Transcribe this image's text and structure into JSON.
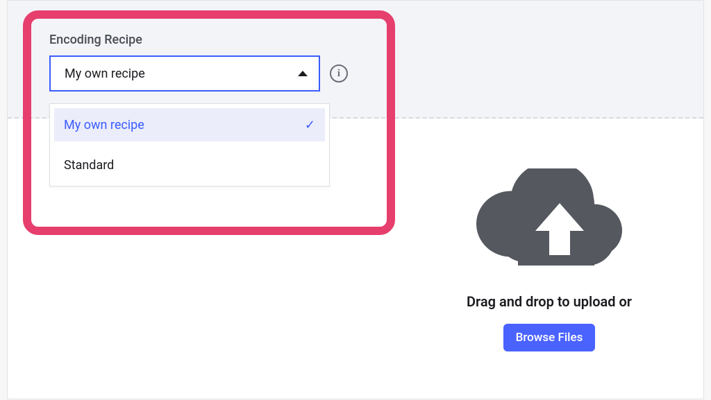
{
  "encoding_recipe": {
    "label": "Encoding Recipe",
    "selected_value": "My own recipe",
    "info_icon": "info-icon",
    "options": [
      {
        "label": "My own recipe",
        "selected": true
      },
      {
        "label": "Standard",
        "selected": false
      }
    ]
  },
  "upload": {
    "instruction": "Drag and drop to upload or",
    "button_label": "Browse Files"
  },
  "colors": {
    "accent": "#3b5cff",
    "highlight_border": "#e63e6d",
    "cloud": "#55585f"
  }
}
